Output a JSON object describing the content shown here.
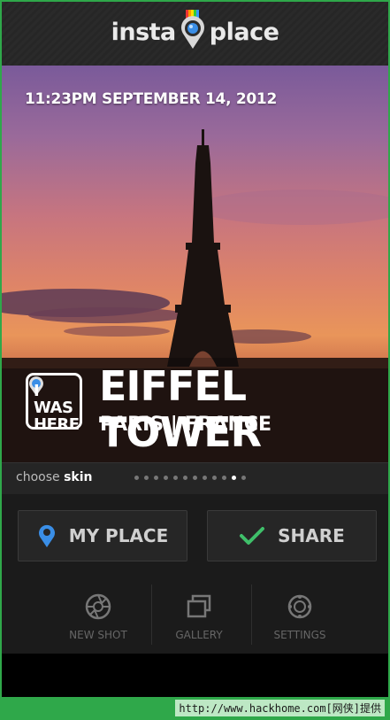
{
  "app": {
    "logo_left": "insta",
    "logo_right": "place"
  },
  "photo": {
    "datetime": "11:23PM  SEPTEMBER 14, 2012",
    "badge_text_line1": "I WAS",
    "badge_text_line2": "HERE",
    "place_name": "EIFFEL TOWER",
    "place_location": "PARIS  |  FRANCE"
  },
  "skin": {
    "label_prefix": "choose ",
    "label_bold": "skin",
    "dot_count": 12,
    "active_dot_index": 10
  },
  "buttons": {
    "my_place": "MY PLACE",
    "share": "SHARE"
  },
  "tools": {
    "new_shot": "NEW SHOT",
    "gallery": "GALLERY",
    "settings": "SETTINGS"
  },
  "footer": {
    "watermark": "http://www.hackhome.com[网侠]提供"
  },
  "colors": {
    "pin_blue": "#3a8ee6",
    "check_green": "#3fbf6a",
    "frame_green": "#2fa84a"
  }
}
